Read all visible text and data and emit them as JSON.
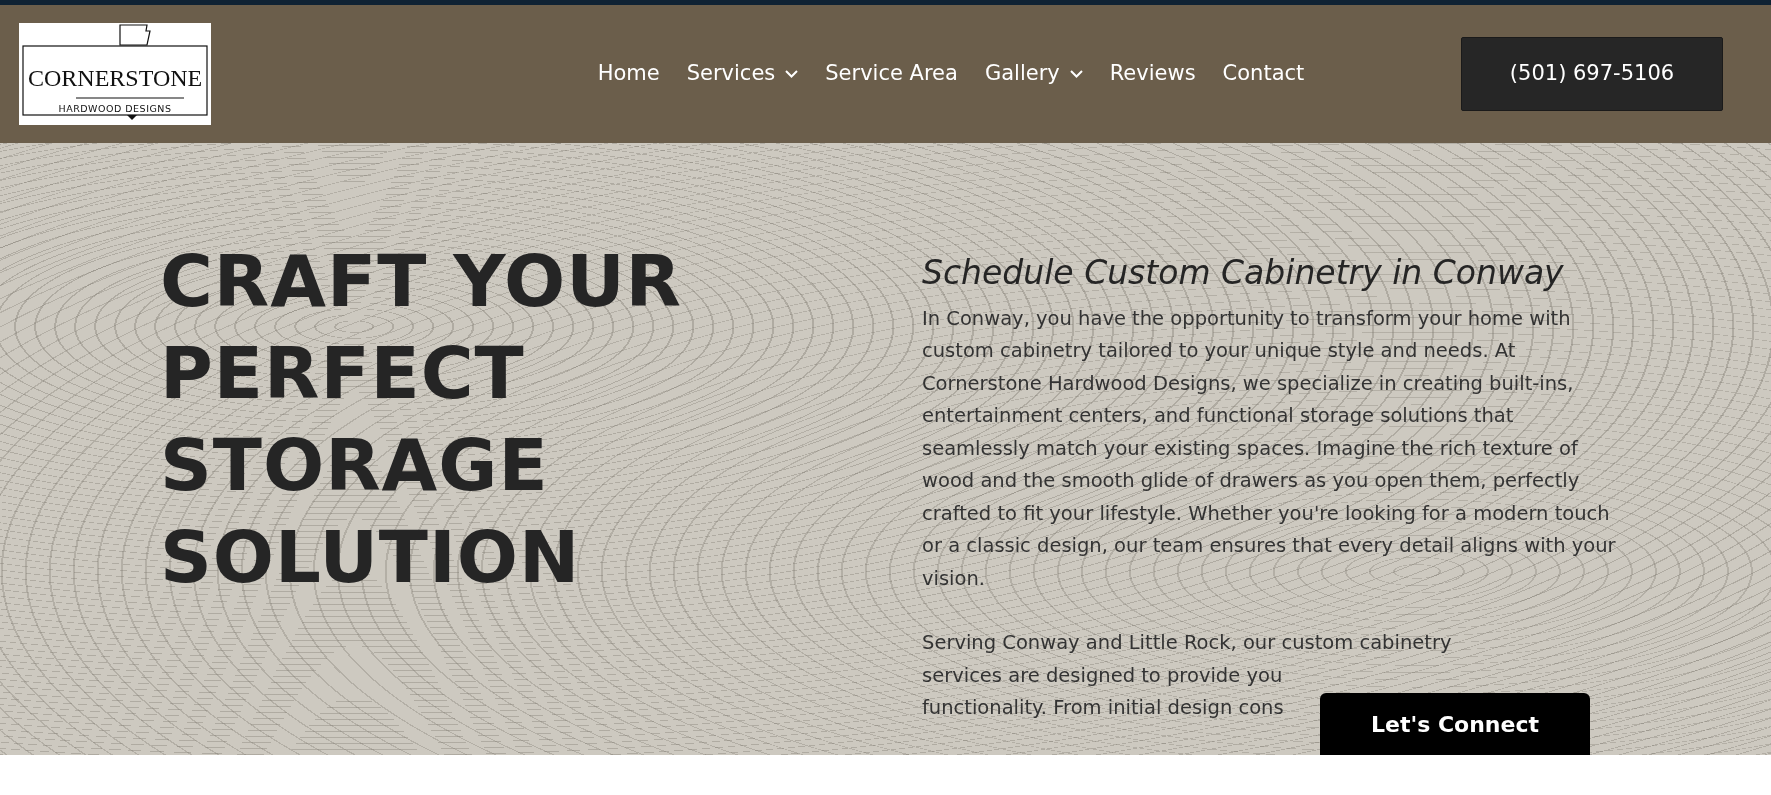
{
  "logo": {
    "title": "CORNERSTONE",
    "subtitle": "HARDWOOD DESIGNS"
  },
  "nav": [
    {
      "label": "Home",
      "dropdown": false
    },
    {
      "label": "Services",
      "dropdown": true
    },
    {
      "label": "Service Area",
      "dropdown": false
    },
    {
      "label": "Gallery",
      "dropdown": true
    },
    {
      "label": "Reviews",
      "dropdown": false
    },
    {
      "label": "Contact",
      "dropdown": false
    }
  ],
  "phone_button": "(501) 697-5106",
  "hero": {
    "heading": "CRAFT YOUR PERFECT STORAGE SOLUTION",
    "subheading": "Schedule Custom Cabinetry in Conway",
    "paragraph": "In Conway, you have the opportunity to transform your home with custom cabinetry tailored to your unique style and needs. At Cornerstone Hardwood Designs, we specialize in creating built-ins, entertainment centers, and functional storage solutions that seamlessly match your existing spaces. Imagine the rich texture of wood and the smooth glide of drawers as you open them, perfectly crafted to fit your lifestyle. Whether you're looking for a modern touch or a classic design, our team ensures that every detail aligns with your vision.",
    "paragraph_2_lines": [
      "Serving Conway and Little Rock, our custom cabinetry",
      "services are designed to provide you",
      "functionality. From initial design cons"
    ]
  },
  "chat_button": "Let's Connect"
}
